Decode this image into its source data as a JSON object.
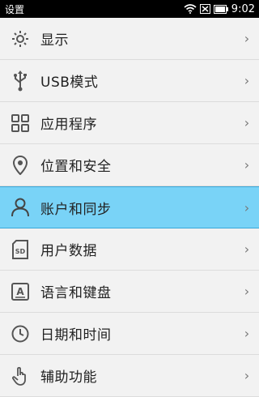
{
  "statusbar": {
    "title": "设置",
    "time": "9:02"
  },
  "menu": {
    "items": [
      {
        "label": "显示",
        "icon": "brightness-icon"
      },
      {
        "label": "USB模式",
        "icon": "usb-icon"
      },
      {
        "label": "应用程序",
        "icon": "apps-grid-icon"
      },
      {
        "label": "位置和安全",
        "icon": "location-pin-icon"
      },
      {
        "label": "账户和同步",
        "icon": "person-icon",
        "selected": true
      },
      {
        "label": "用户数据",
        "icon": "sd-card-icon"
      },
      {
        "label": "语言和键盘",
        "icon": "language-keyboard-icon"
      },
      {
        "label": "日期和时间",
        "icon": "clock-icon"
      },
      {
        "label": "辅助功能",
        "icon": "hand-pointer-icon"
      }
    ],
    "chevron": "›"
  },
  "colors": {
    "selected_bg": "#79d3f7",
    "bg": "#f2f2f2"
  }
}
